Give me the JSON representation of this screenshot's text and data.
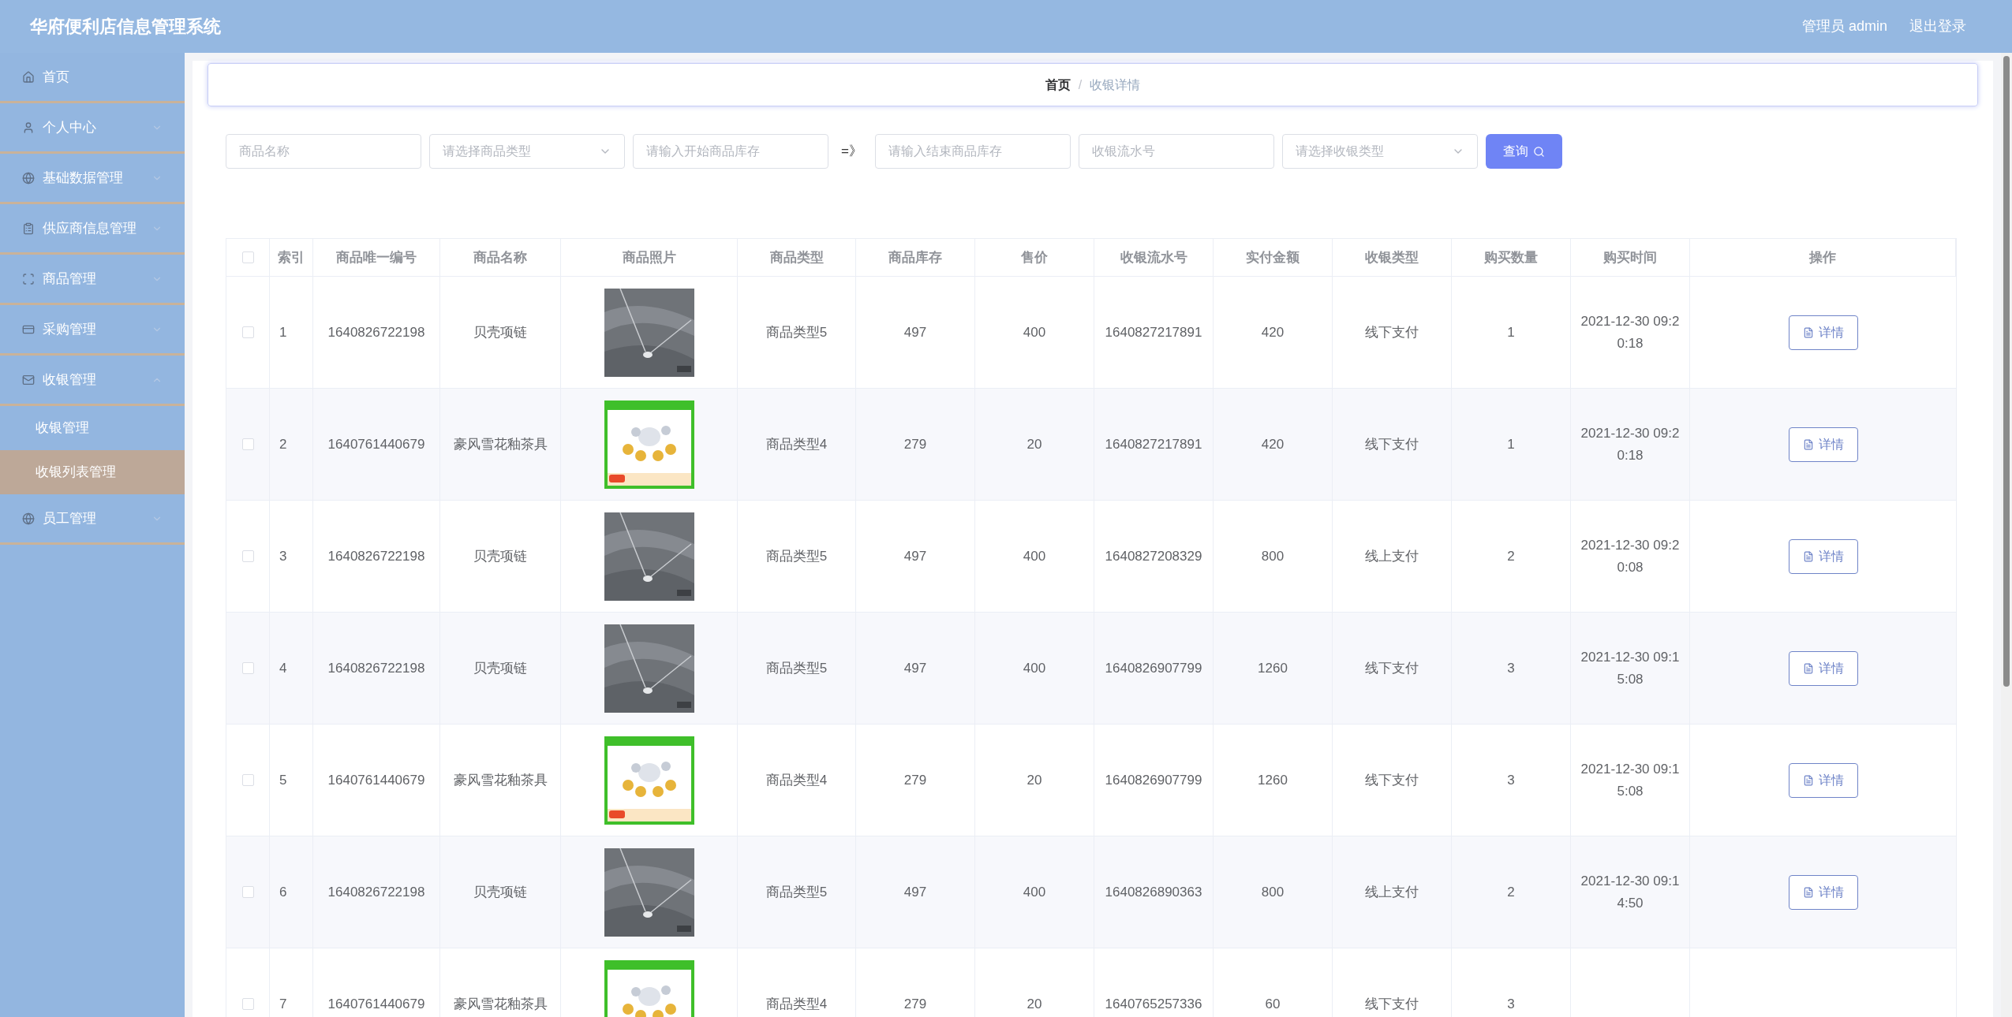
{
  "header": {
    "title": "华府便利店信息管理系统",
    "user": "管理员 admin",
    "logout": "退出登录"
  },
  "sidebar": {
    "items": [
      {
        "label": "首页",
        "kind": "link"
      },
      {
        "label": "个人中心",
        "kind": "group",
        "expanded": false
      },
      {
        "label": "基础数据管理",
        "kind": "group",
        "expanded": false
      },
      {
        "label": "供应商信息管理",
        "kind": "group",
        "expanded": false
      },
      {
        "label": "商品管理",
        "kind": "group",
        "expanded": false
      },
      {
        "label": "采购管理",
        "kind": "group",
        "expanded": false
      },
      {
        "label": "收银管理",
        "kind": "group",
        "expanded": true,
        "children": [
          {
            "label": "收银管理",
            "selected": false
          },
          {
            "label": "收银列表管理",
            "selected": true
          }
        ]
      },
      {
        "label": "员工管理",
        "kind": "group",
        "expanded": false
      }
    ]
  },
  "breadcrumb": {
    "separator": "/",
    "items": [
      {
        "label": "首页",
        "current": false
      },
      {
        "label": "收银详情",
        "current": true
      }
    ]
  },
  "filters": [
    {
      "kind": "input",
      "placeholder": "商品名称"
    },
    {
      "kind": "select",
      "placeholder": "请选择商品类型"
    },
    {
      "kind": "input",
      "placeholder": "请输入开始商品库存"
    },
    {
      "kind": "separator",
      "text": "=》"
    },
    {
      "kind": "input",
      "placeholder": "请输入结束商品库存"
    },
    {
      "kind": "input",
      "placeholder": "收银流水号"
    },
    {
      "kind": "select",
      "placeholder": "请选择收银类型"
    }
  ],
  "search_button": "查询",
  "table": {
    "select_all_checked": false,
    "columns": [
      "索引",
      "商品唯一编号",
      "商品名称",
      "商品照片",
      "商品类型",
      "商品库存",
      "售价",
      "收银流水号",
      "实付金额",
      "收银类型",
      "购买数量",
      "购买时间",
      "操作"
    ],
    "rows": [
      {
        "checked": false,
        "cells": [
          "1",
          "1640826722198",
          "贝壳项链",
          {
            "kind": "picture"
          },
          "商品类型5",
          "497",
          "400",
          "1640827217891",
          "420",
          "线下支付",
          "1",
          "2021-12-30 09:20:18"
        ],
        "action": "详情"
      },
      {
        "checked": false,
        "cells": [
          "2",
          "1640761440679",
          "豪风雪花釉茶具",
          {
            "kind": "picture"
          },
          "商品类型4",
          "279",
          "20",
          "1640827217891",
          "420",
          "线下支付",
          "1",
          "2021-12-30 09:20:18"
        ],
        "action": "详情"
      },
      {
        "checked": false,
        "cells": [
          "3",
          "1640826722198",
          "贝壳项链",
          {
            "kind": "picture"
          },
          "商品类型5",
          "497",
          "400",
          "1640827208329",
          "800",
          "线上支付",
          "2",
          "2021-12-30 09:20:08"
        ],
        "action": "详情"
      },
      {
        "checked": false,
        "cells": [
          "4",
          "1640826722198",
          "贝壳项链",
          {
            "kind": "picture"
          },
          "商品类型5",
          "497",
          "400",
          "1640826907799",
          "1260",
          "线下支付",
          "3",
          "2021-12-30 09:15:08"
        ],
        "action": "详情"
      },
      {
        "checked": false,
        "cells": [
          "5",
          "1640761440679",
          "豪风雪花釉茶具",
          {
            "kind": "picture"
          },
          "商品类型4",
          "279",
          "20",
          "1640826907799",
          "1260",
          "线下支付",
          "3",
          "2021-12-30 09:15:08"
        ],
        "action": "详情"
      },
      {
        "checked": false,
        "cells": [
          "6",
          "1640826722198",
          "贝壳项链",
          {
            "kind": "picture"
          },
          "商品类型5",
          "497",
          "400",
          "1640826890363",
          "800",
          "线上支付",
          "2",
          "2021-12-30 09:14:50"
        ],
        "action": "详情"
      },
      {
        "checked": false,
        "cells": [
          "7",
          "1640761440679",
          "豪风雪花釉茶具",
          {
            "kind": "picture"
          },
          "商品类型4",
          "279",
          "20",
          "1640765257336",
          "60",
          "线下支付",
          "3"
        ]
      }
    ]
  }
}
